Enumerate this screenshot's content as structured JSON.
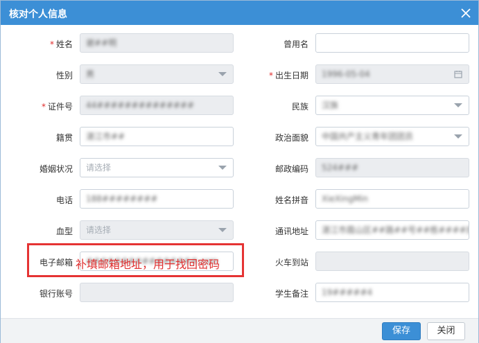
{
  "dialog": {
    "title": "核对个人信息"
  },
  "fields": {
    "name": {
      "label": "姓名",
      "required": true,
      "value": "谢##明"
    },
    "alias": {
      "label": "曾用名",
      "value": ""
    },
    "gender": {
      "label": "性别",
      "value": "男"
    },
    "birth": {
      "label": "出生日期",
      "required": true,
      "value": "1996-05-04"
    },
    "id_no": {
      "label": "证件号",
      "required": true,
      "value": "44##############"
    },
    "ethnic": {
      "label": "民族",
      "value": "汉族"
    },
    "native": {
      "label": "籍贯",
      "value": "湛江市##"
    },
    "politics": {
      "label": "政治面貌",
      "value": "中国共产主义青年团团员"
    },
    "marital": {
      "label": "婚姻状况",
      "placeholder": "请选择"
    },
    "postcode": {
      "label": "邮政编码",
      "value": "524###"
    },
    "phone": {
      "label": "电话",
      "value": "188########"
    },
    "pinyin": {
      "label": "姓名拼音",
      "value": "XieXingMin"
    },
    "blood": {
      "label": "血型",
      "placeholder": "请选择"
    },
    "address": {
      "label": "通讯地址",
      "value": "湛江市霞山区##路##号##栋####房"
    },
    "email": {
      "label": "电子邮箱",
      "value": "################.com"
    },
    "station": {
      "label": "火车到站",
      "value": ""
    },
    "bank": {
      "label": "银行账号",
      "value": ""
    },
    "note": {
      "label": "学生备注",
      "value": "19#####4"
    }
  },
  "annotation": {
    "text": "补填邮箱地址，用于找回密码"
  },
  "footer": {
    "save_label": "保存",
    "close_label": "关闭"
  },
  "colors": {
    "header": "#3c8fd6",
    "required": "#e02b2b",
    "highlight": "#e53333"
  }
}
